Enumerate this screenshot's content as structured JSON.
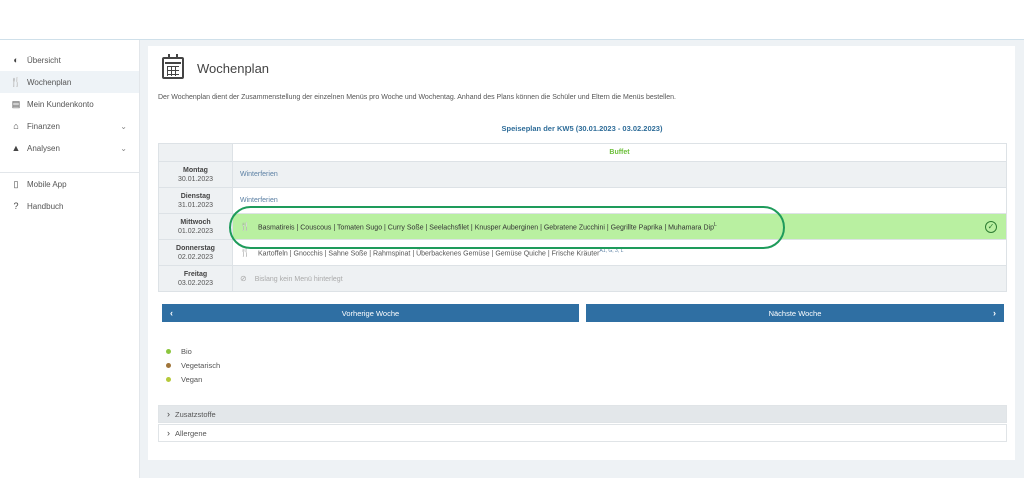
{
  "sidebar": {
    "items": [
      {
        "label": "Übersicht",
        "icon": "dashboard-icon",
        "glyph": "◐"
      },
      {
        "label": "Wochenplan",
        "icon": "cutlery-icon",
        "glyph": "🍴"
      },
      {
        "label": "Mein Kundenkonto",
        "icon": "id-card-icon",
        "glyph": "▤"
      },
      {
        "label": "Finanzen",
        "icon": "bank-icon",
        "glyph": "⌂"
      },
      {
        "label": "Analysen",
        "icon": "area-chart-icon",
        "glyph": "▲"
      },
      {
        "label": "Mobile App",
        "icon": "mobile-icon",
        "glyph": "▯"
      },
      {
        "label": "Handbuch",
        "icon": "help-circle-icon",
        "glyph": "?"
      }
    ]
  },
  "page": {
    "title": "Wochenplan",
    "description": "Der Wochenplan dient der Zusammenstellung der einzelnen Menüs pro Woche und Wochentag. Anhand des Plans können die Schüler und Eltern die Menüs bestellen.",
    "plan_title": "Speiseplan der KW5 (30.01.2023 - 03.02.2023)",
    "column_header": "Buffet"
  },
  "days": [
    {
      "name": "Montag",
      "date": "30.01.2023",
      "text": "Winterferien",
      "sup": ""
    },
    {
      "name": "Dienstag",
      "date": "31.01.2023",
      "text": "Winterferien",
      "sup": ""
    },
    {
      "name": "Mittwoch",
      "date": "01.02.2023",
      "text": "Basmatireis | Couscous | Tomaten Sugo | Curry Soße | Seelachsfilet | Knusper Auberginen | Gebratene Zucchini | Gegrillte Paprika | Muhamara Dip",
      "sup": "L"
    },
    {
      "name": "Donnerstag",
      "date": "02.02.2023",
      "text": "Kartoffeln | Gnocchis | Sahne Soße | Rahmspinat | Überbackenes Gemüse | Gemüse Quiche | Frische Kräuter",
      "sup": "A1, G, 3, L"
    },
    {
      "name": "Freitag",
      "date": "03.02.2023",
      "text": "Bislang kein Menü hinterlegt",
      "sup": ""
    }
  ],
  "nav": {
    "prev": "Vorherige Woche",
    "next": "Nächste Woche"
  },
  "legend": [
    {
      "label": "Bio",
      "color": "#8cc63f"
    },
    {
      "label": "Vegetarisch",
      "color": "#a0753a"
    },
    {
      "label": "Vegan",
      "color": "#b5c93a"
    }
  ],
  "accordions": {
    "zusatzstoffe": "Zusatzstoffe",
    "allergene": "Allergene"
  }
}
